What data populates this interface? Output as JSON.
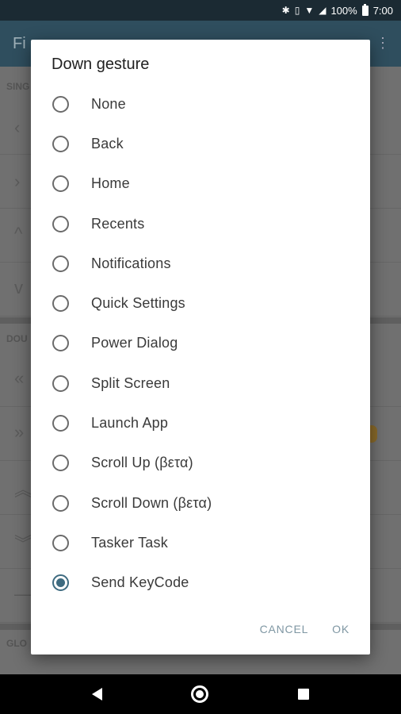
{
  "status_bar": {
    "battery_percent": "100%",
    "time": "7:00",
    "icons": [
      "bluetooth-icon",
      "vibrate-icon",
      "wifi-icon",
      "lte-signal-icon",
      "battery-icon"
    ]
  },
  "app_bar": {
    "title": "Fi"
  },
  "background_sections": {
    "single": "SING",
    "double": "DOU",
    "global": "GLO"
  },
  "dialog": {
    "title": "Down gesture",
    "options": [
      {
        "label": "None",
        "selected": false
      },
      {
        "label": "Back",
        "selected": false
      },
      {
        "label": "Home",
        "selected": false
      },
      {
        "label": "Recents",
        "selected": false
      },
      {
        "label": "Notifications",
        "selected": false
      },
      {
        "label": "Quick Settings",
        "selected": false
      },
      {
        "label": "Power Dialog",
        "selected": false
      },
      {
        "label": "Split Screen",
        "selected": false
      },
      {
        "label": "Launch App",
        "selected": false
      },
      {
        "label": "Scroll Up (βετα)",
        "selected": false
      },
      {
        "label": "Scroll Down (βετα)",
        "selected": false
      },
      {
        "label": "Tasker Task",
        "selected": false
      },
      {
        "label": "Send KeyCode",
        "selected": true
      }
    ],
    "cancel_label": "CANCEL",
    "ok_label": "OK"
  },
  "colors": {
    "accent": "#3e6b80",
    "status_bar": "#1b2a33",
    "app_bar": "#2f4e5e"
  }
}
